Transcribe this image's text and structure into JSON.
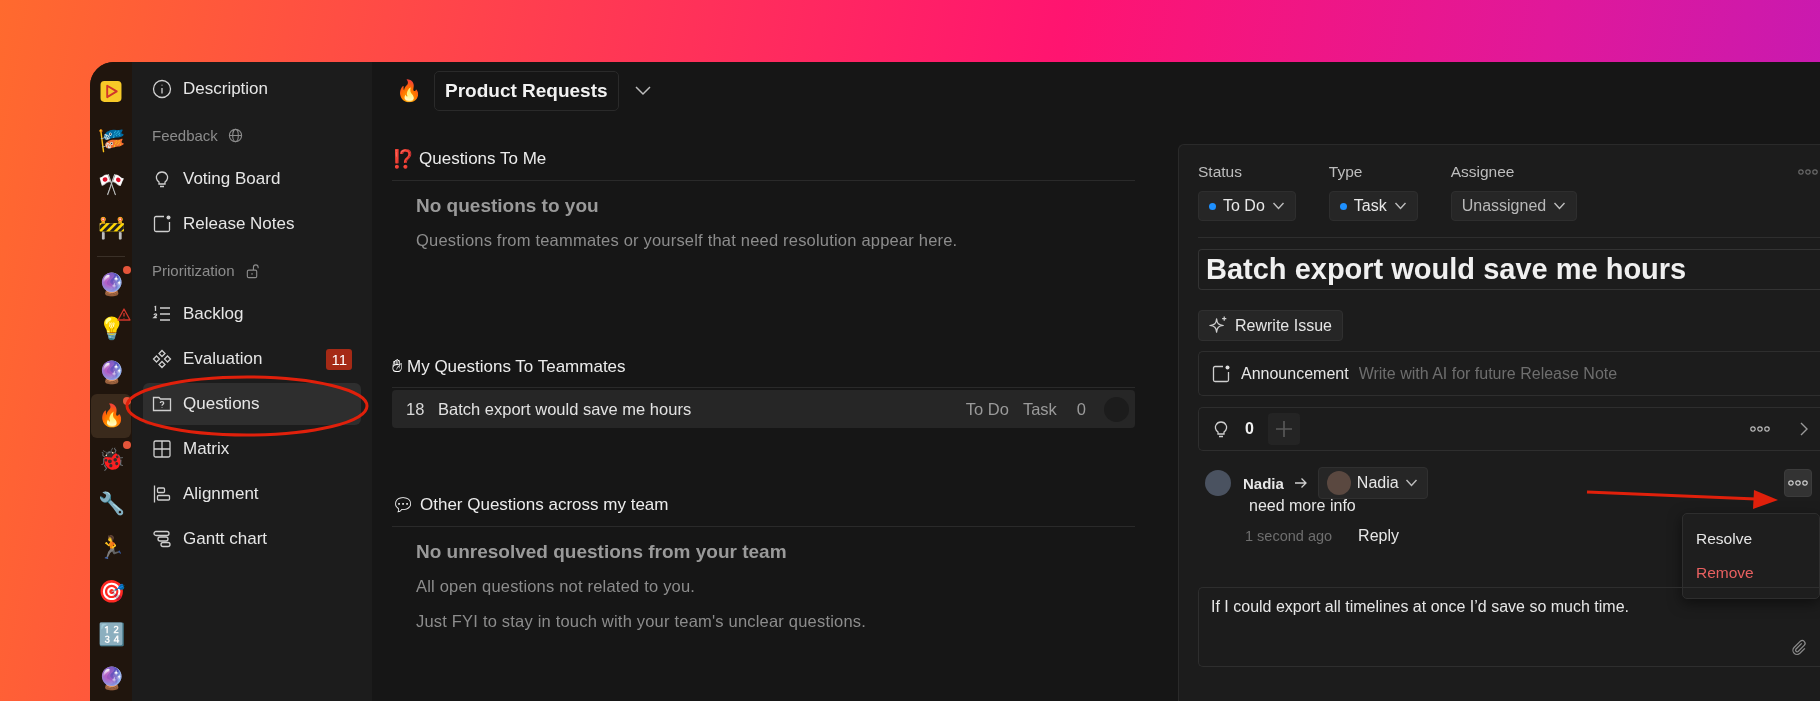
{
  "strip": {
    "groups": [
      [
        {
          "emoji": "🎏",
          "dot": false,
          "warning": false,
          "selected": false
        },
        {
          "emoji": "🎌",
          "dot": false,
          "warning": false,
          "selected": false
        },
        {
          "emoji": "🚧",
          "dot": false,
          "warning": false,
          "selected": false
        }
      ],
      [
        {
          "emoji": "🔮",
          "dot": true,
          "warning": false,
          "selected": false
        },
        {
          "emoji": "💡",
          "dot": false,
          "warning": true,
          "selected": false
        },
        {
          "emoji": "🔮",
          "dot": false,
          "warning": false,
          "selected": false
        },
        {
          "emoji": "🔥",
          "dot": true,
          "warning": false,
          "selected": true
        },
        {
          "emoji": "🐞",
          "dot": true,
          "warning": false,
          "selected": false
        },
        {
          "emoji": "🔧",
          "dot": false,
          "warning": false,
          "selected": false
        },
        {
          "emoji": "🏃",
          "dot": false,
          "warning": false,
          "selected": false
        },
        {
          "emoji": "🎯",
          "dot": false,
          "warning": false,
          "selected": false
        },
        {
          "emoji": "🔢",
          "dot": false,
          "warning": false,
          "selected": false
        },
        {
          "emoji": "🔮",
          "dot": false,
          "warning": false,
          "selected": false
        }
      ]
    ]
  },
  "sidebar": {
    "items": [
      {
        "kind": "link",
        "label": "Description",
        "selected": false
      },
      {
        "kind": "section",
        "label": "Feedback"
      },
      {
        "kind": "link",
        "label": "Voting Board",
        "selected": false
      },
      {
        "kind": "link",
        "label": "Release Notes",
        "selected": false
      },
      {
        "kind": "section",
        "label": "Prioritization"
      },
      {
        "kind": "link",
        "label": "Backlog",
        "selected": false
      },
      {
        "kind": "link",
        "label": "Evaluation",
        "selected": false,
        "badge": "11"
      },
      {
        "kind": "link",
        "label": "Questions",
        "selected": true
      },
      {
        "kind": "link",
        "label": "Matrix",
        "selected": false
      },
      {
        "kind": "link",
        "label": "Alignment",
        "selected": false
      },
      {
        "kind": "link",
        "label": "Gantt chart",
        "selected": false
      }
    ]
  },
  "header": {
    "emoji": "🔥",
    "title": "Product Requests"
  },
  "sections": [
    {
      "emoji": "⁉️",
      "title": "Questions To Me",
      "empty_title": "No questions to you",
      "empty_lines": [
        "Questions from teammates or yourself that need resolution appear here."
      ]
    },
    {
      "emoji": "✋",
      "title": "My Questions To Teammates",
      "rows": [
        {
          "number": "18",
          "title": "Batch export would save me hours",
          "status": "To Do",
          "type": "Task",
          "count": "0"
        }
      ]
    },
    {
      "emoji": "💬",
      "title": "Other Questions across my team",
      "empty_title": "No unresolved questions from your team",
      "empty_lines": [
        "All open questions not related to you.",
        "Just FYI to stay in touch with your team's unclear questions."
      ]
    }
  ],
  "issue": {
    "fields": [
      {
        "label": "Status",
        "value": "To Do",
        "color": "#1e90ff"
      },
      {
        "label": "Type",
        "value": "Task",
        "color": "#1e90ff"
      },
      {
        "label": "Assignee",
        "value": "Unassigned"
      }
    ],
    "title": "Batch export would save me hours",
    "rewrite_button": "Rewrite Issue",
    "announcement": {
      "label": "Announcement",
      "placeholder": "Write with AI for future Release Note"
    },
    "votes": "0",
    "comment": {
      "author": "Nadia",
      "assignee": "Nadia",
      "text": "need more info",
      "time": "1 second ago",
      "reply": "Reply"
    },
    "menu": [
      {
        "label": "Resolve",
        "kind": "normal"
      },
      {
        "label": "Remove",
        "kind": "danger"
      }
    ],
    "description": "If I could export all timelines at once I’d save so much time."
  }
}
